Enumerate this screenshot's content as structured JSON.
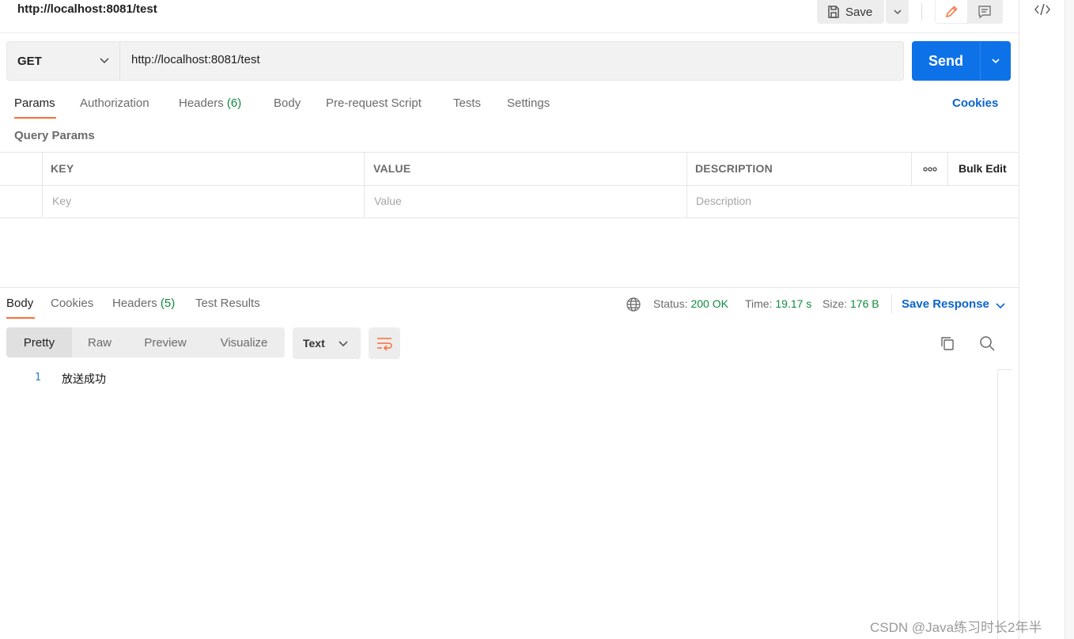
{
  "request": {
    "title": "http://localhost:8081/test",
    "save_label": "Save",
    "method": "GET",
    "url": "http://localhost:8081/test",
    "send_label": "Send"
  },
  "request_tabs": {
    "params": "Params",
    "authorization": "Authorization",
    "headers": "Headers",
    "headers_count": "(6)",
    "body": "Body",
    "pre_request_script": "Pre-request Script",
    "tests": "Tests",
    "settings": "Settings",
    "cookies": "Cookies"
  },
  "query_params": {
    "label": "Query Params",
    "columns": {
      "key": "KEY",
      "value": "VALUE",
      "description": "DESCRIPTION"
    },
    "bulk_edit": "Bulk Edit",
    "placeholders": {
      "key": "Key",
      "value": "Value",
      "description": "Description"
    }
  },
  "response_tabs": {
    "body": "Body",
    "cookies": "Cookies",
    "headers": "Headers",
    "headers_count": "(5)",
    "test_results": "Test Results"
  },
  "response_status": {
    "status_label": "Status:",
    "status_value": "200 OK",
    "time_label": "Time:",
    "time_value": "19.17 s",
    "size_label": "Size:",
    "size_value": "176 B",
    "save_response": "Save Response"
  },
  "response_view": {
    "modes": [
      "Pretty",
      "Raw",
      "Preview",
      "Visualize"
    ],
    "active_mode": "Pretty",
    "format": "Text"
  },
  "response_body": {
    "lines": [
      {
        "number": "1",
        "text": "放送成功"
      }
    ]
  },
  "watermark": "CSDN @Java练习时长2年半",
  "colors": {
    "accent_orange": "#ff6c37",
    "send_blue": "#0d72e8",
    "link_blue": "#0b64cf",
    "status_green": "#0f8a3c"
  }
}
